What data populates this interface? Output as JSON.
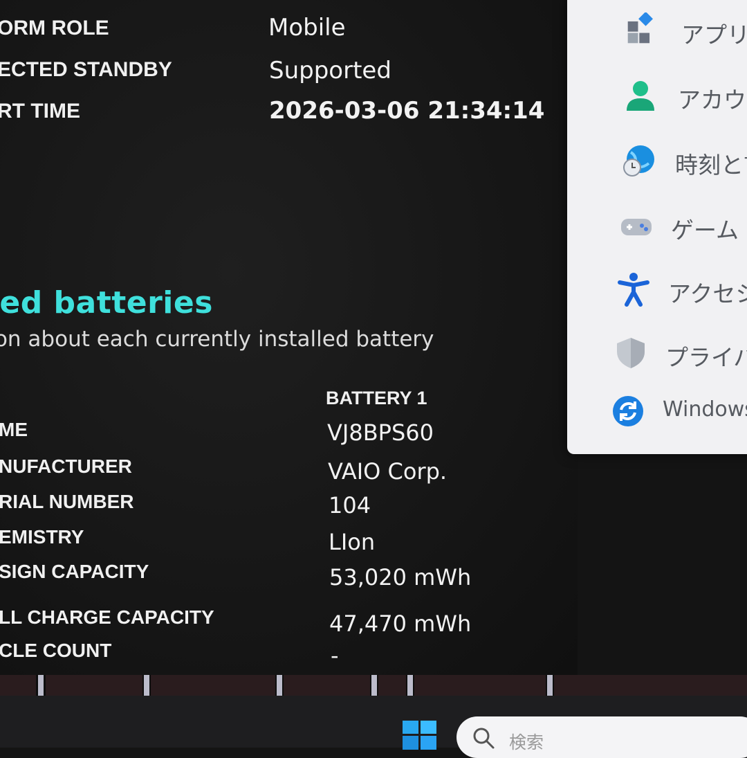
{
  "system_info": {
    "rows": [
      {
        "label": "ORM ROLE",
        "value": "Mobile"
      },
      {
        "label": "ECTED STANDBY",
        "value": "Supported"
      },
      {
        "label": "RT TIME",
        "value": "2026-03-06  21:34:14"
      }
    ]
  },
  "batteries": {
    "title": "alled batteries",
    "subtitle": "mation about each currently installed battery",
    "column_header": "BATTERY 1",
    "rows": [
      {
        "label": "ME",
        "value": "VJ8BPS60"
      },
      {
        "label": "NUFACTURER",
        "value": "VAIO Corp."
      },
      {
        "label": "RIAL NUMBER",
        "value": "104"
      },
      {
        "label": "EMISTRY",
        "value": "LIon"
      },
      {
        "label": "SIGN CAPACITY",
        "value": "53,020 mWh"
      },
      {
        "label": "LL CHARGE CAPACITY",
        "value": "47,470 mWh"
      },
      {
        "label": "CLE COUNT",
        "value": "-"
      }
    ]
  },
  "settings_flyout": {
    "items": [
      {
        "label": "アプリ",
        "icon": "apps-icon"
      },
      {
        "label": "アカウン",
        "icon": "account-icon"
      },
      {
        "label": "時刻と言",
        "icon": "time-language-icon"
      },
      {
        "label": "ゲーム",
        "icon": "gaming-icon"
      },
      {
        "label": "アクセシビ",
        "icon": "accessibility-icon"
      },
      {
        "label": "プライバシ",
        "icon": "privacy-shield-icon"
      },
      {
        "label": "Windows",
        "icon": "windows-update-icon"
      }
    ]
  },
  "taskbar": {
    "search_placeholder": "検索"
  },
  "colors": {
    "accent_teal": "#3fe0dc",
    "background": "#141414",
    "flyout_bg": "#f1f1f3"
  }
}
